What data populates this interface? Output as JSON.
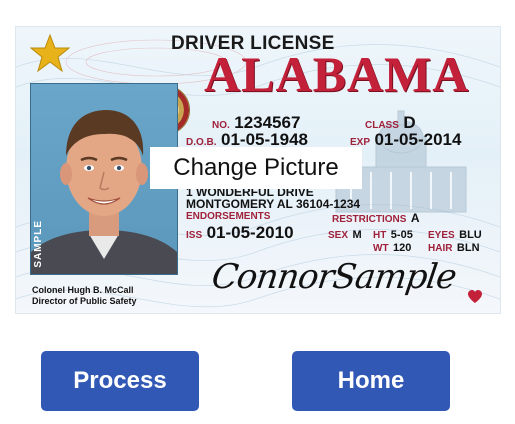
{
  "license": {
    "title": "DRIVER LICENSE",
    "state": "ALABAMA",
    "photo_side_label": "SAMPLE",
    "no_label": "NO.",
    "number": "1234567",
    "class_label": "CLASS",
    "class_value": "D",
    "dob_label": "D.O.B.",
    "dob": "01-05-1948",
    "exp_label": "EXP",
    "exp": "01-05-2014",
    "address_line1": "1 WONDERFUL DRIVE",
    "address_line2": "MONTGOMERY AL 36104-1234",
    "endorsements_label": "ENDORSEMENTS",
    "restrictions_label": "RESTRICTIONS",
    "restrictions_value": "A",
    "iss_label": "ISS",
    "iss": "01-05-2010",
    "sex_label": "SEX",
    "sex": "M",
    "ht_label": "HT",
    "ht": "5-05",
    "wt_label": "WT",
    "wt": "120",
    "eyes_label": "EYES",
    "eyes": "BLU",
    "hair_label": "HAIR",
    "hair": "BLN",
    "signature": "ConnorSample",
    "official_name": "Colonel Hugh B. McCall",
    "official_title": "Director of Public Safety"
  },
  "overlay": {
    "change_picture_label": "Change Picture"
  },
  "actions": {
    "process_label": "Process",
    "home_label": "Home"
  },
  "colors": {
    "button_bg": "#3158b4",
    "state_red": "#c3203a",
    "star_gold": "#e8b21a"
  }
}
